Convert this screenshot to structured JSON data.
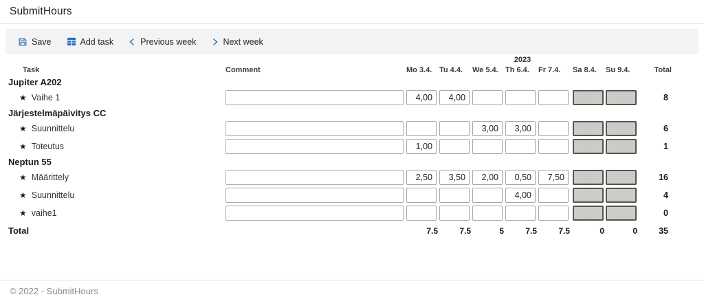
{
  "app": {
    "title": "SubmitHours",
    "footer": "© 2022 - SubmitHours"
  },
  "toolbar": {
    "save": "Save",
    "add_task": "Add task",
    "prev_week": "Previous week",
    "next_week": "Next week"
  },
  "table": {
    "year": "2023",
    "task_header": "Task",
    "comment_header": "Comment",
    "total_header": "Total",
    "days": [
      "Mo 3.4.",
      "Tu 4.4.",
      "We 5.4.",
      "Th 6.4.",
      "Fr 7.4.",
      "Sa 8.4.",
      "Su 9.4."
    ],
    "weekend_days": [
      5,
      6
    ],
    "groups": [
      {
        "name": "Jupiter A202",
        "tasks": [
          {
            "name": "Vaihe 1",
            "comment": "",
            "hours": [
              "4,00",
              "4,00",
              "",
              "",
              "",
              "",
              ""
            ],
            "total": "8"
          }
        ]
      },
      {
        "name": "Järjestelmäpäivitys CC",
        "tasks": [
          {
            "name": "Suunnittelu",
            "comment": "",
            "hours": [
              "",
              "",
              "3,00",
              "3,00",
              "",
              "",
              ""
            ],
            "total": "6"
          },
          {
            "name": "Toteutus",
            "comment": "",
            "hours": [
              "1,00",
              "",
              "",
              "",
              "",
              "",
              ""
            ],
            "total": "1"
          }
        ]
      },
      {
        "name": "Neptun 55",
        "tasks": [
          {
            "name": "Määrittely",
            "comment": "",
            "hours": [
              "2,50",
              "3,50",
              "2,00",
              "0,50",
              "7,50",
              "",
              ""
            ],
            "total": "16"
          },
          {
            "name": "Suunnittelu",
            "comment": "",
            "hours": [
              "",
              "",
              "",
              "4,00",
              "",
              "",
              ""
            ],
            "total": "4"
          },
          {
            "name": "vaihe1",
            "comment": "",
            "hours": [
              "",
              "",
              "",
              "",
              "",
              "",
              ""
            ],
            "total": "0"
          }
        ]
      }
    ],
    "total_row": {
      "label": "Total",
      "day_totals": [
        "7.5",
        "7.5",
        "5",
        "7.5",
        "7.5",
        "0",
        "0"
      ],
      "grand_total": "35"
    }
  },
  "colors": {
    "accent_blue": "#2b72be",
    "toolbar_bg": "#f3f3f3",
    "weekend_fill": "#d1cfcc",
    "weekend_border": "#55544f"
  }
}
